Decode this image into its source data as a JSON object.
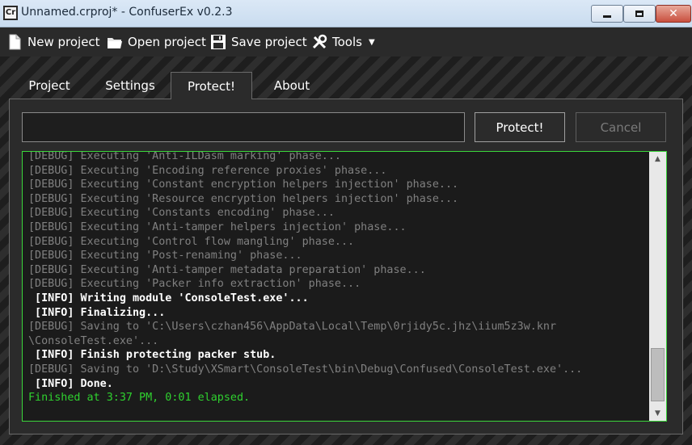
{
  "window": {
    "title": "Unnamed.crproj* - ConfuserEx v0.2.3",
    "app_icon": "Cr",
    "icons": {
      "app": "confuserex-icon",
      "minimize": "minimize-icon",
      "maximize": "maximize-icon",
      "close": "close-icon"
    }
  },
  "toolbar": {
    "new_label": "New project",
    "open_label": "Open project",
    "save_label": "Save project",
    "tools_label": "Tools"
  },
  "tabs": [
    {
      "label": "Project"
    },
    {
      "label": "Settings"
    },
    {
      "label": "Protect!",
      "selected": true
    },
    {
      "label": "About"
    }
  ],
  "protect": {
    "input_value": "",
    "protect_label": "Protect!",
    "cancel_label": "Cancel",
    "log": [
      {
        "level": "debug",
        "text": "[DEBUG] Executing 'Anti-ILDasm marking' phase..."
      },
      {
        "level": "debug",
        "text": "[DEBUG] Executing 'Encoding reference proxies' phase..."
      },
      {
        "level": "debug",
        "text": "[DEBUG] Executing 'Constant encryption helpers injection' phase..."
      },
      {
        "level": "debug",
        "text": "[DEBUG] Executing 'Resource encryption helpers injection' phase..."
      },
      {
        "level": "debug",
        "text": "[DEBUG] Executing 'Constants encoding' phase..."
      },
      {
        "level": "debug",
        "text": "[DEBUG] Executing 'Anti-tamper helpers injection' phase..."
      },
      {
        "level": "debug",
        "text": "[DEBUG] Executing 'Control flow mangling' phase..."
      },
      {
        "level": "debug",
        "text": "[DEBUG] Executing 'Post-renaming' phase..."
      },
      {
        "level": "debug",
        "text": "[DEBUG] Executing 'Anti-tamper metadata preparation' phase..."
      },
      {
        "level": "debug",
        "text": "[DEBUG] Executing 'Packer info extraction' phase..."
      },
      {
        "level": "info",
        "text": " [INFO] Writing module 'ConsoleTest.exe'..."
      },
      {
        "level": "info",
        "text": " [INFO] Finalizing..."
      },
      {
        "level": "debug",
        "text": "[DEBUG] Saving to 'C:\\Users\\czhan456\\AppData\\Local\\Temp\\0rjidy5c.jhz\\iium5z3w.knr"
      },
      {
        "level": "debug",
        "text": "\\ConsoleTest.exe'..."
      },
      {
        "level": "info",
        "text": " [INFO] Finish protecting packer stub."
      },
      {
        "level": "debug",
        "text": "[DEBUG] Saving to 'D:\\Study\\XSmart\\ConsoleTest\\bin\\Debug\\Confused\\ConsoleTest.exe'..."
      },
      {
        "level": "info",
        "text": " [INFO] Done."
      },
      {
        "level": "done",
        "text": "Finished at 3:37 PM, 0:01 elapsed."
      }
    ]
  },
  "colors": {
    "log_border": "#3bd63b",
    "finished_text": "#2fd12f",
    "debug_text": "#808080"
  }
}
